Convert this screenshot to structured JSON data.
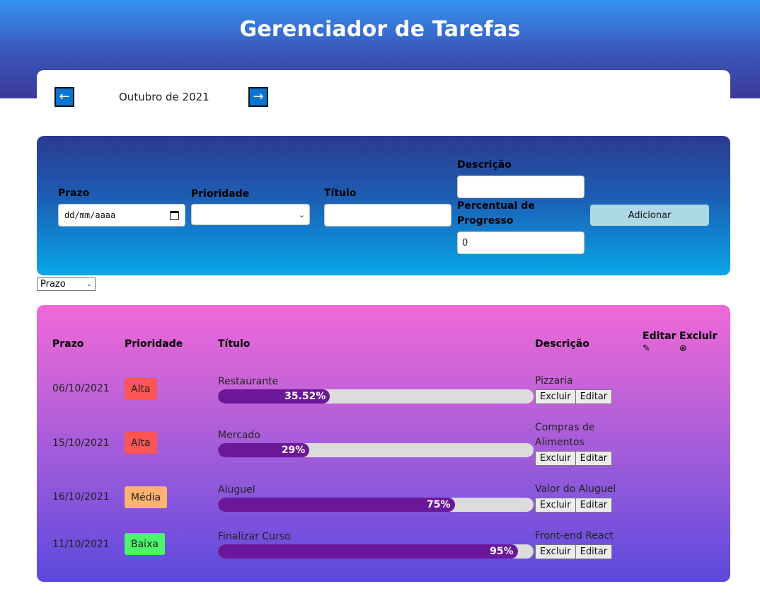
{
  "header": {
    "title": "Gerenciador de Tarefas"
  },
  "month_nav": {
    "prev_icon": "←",
    "next_icon": "→",
    "label": "Outubro de 2021"
  },
  "form": {
    "prazo_label": "Prazo",
    "prazo_placeholder": "dd/mm/aaaa",
    "prioridade_label": "Prioridade",
    "titulo_label": "Título",
    "descricao_label": "Descrição",
    "progresso_label": "Percentual de Progresso",
    "progresso_value": "0",
    "add_button": "Adicionar"
  },
  "sort": {
    "selected": "Prazo"
  },
  "table": {
    "headers": {
      "prazo": "Prazo",
      "prioridade": "Prioridade",
      "titulo": "Título",
      "descricao": "Descrição",
      "editar": "Editar",
      "excluir": "Excluir",
      "editar_icon": "✎",
      "excluir_icon": "⊗"
    },
    "row_buttons": {
      "excluir": "Excluir",
      "editar": "Editar"
    },
    "rows": [
      {
        "date": "06/10/2021",
        "priority": "Alta",
        "priority_color": "#fc5555",
        "title": "Restaurante",
        "progress": 35.52,
        "progress_label": "35.52%",
        "description": "Pizzaria"
      },
      {
        "date": "15/10/2021",
        "priority": "Alta",
        "priority_color": "#fc5555",
        "title": "Mercado",
        "progress": 29,
        "progress_label": "29%",
        "description": "Compras de Alimentos"
      },
      {
        "date": "16/10/2021",
        "priority": "Média",
        "priority_color": "#ffb370",
        "title": "Aluguel",
        "progress": 75,
        "progress_label": "75%",
        "description": "Valor do Aluguel"
      },
      {
        "date": "11/10/2021",
        "priority": "Baixa",
        "priority_color": "#4cf56a",
        "title": "Finalizar Curso",
        "progress": 95,
        "progress_label": "95%",
        "description": "Front-end React"
      }
    ]
  },
  "colors": {
    "progress_fill": "#6a1799",
    "nav_button": "#0a74d1",
    "add_button": "#add8e6"
  }
}
